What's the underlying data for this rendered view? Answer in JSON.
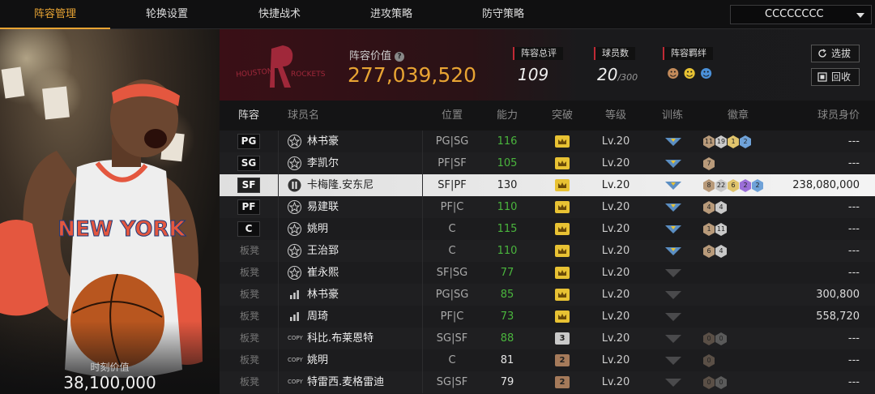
{
  "nav": {
    "tabs": [
      "阵容管理",
      "轮换设置",
      "快捷战术",
      "进攻策略",
      "防守策略"
    ],
    "active_index": 0,
    "account_dropdown": "CCCCCCCC"
  },
  "player_panel": {
    "value_label": "时刻价值",
    "value": "38,100,000"
  },
  "team": {
    "logo_text": "HOUSTON ROCKETS",
    "lineup_value_label": "阵容价值",
    "lineup_value": "277,039,520",
    "rating_label": "阵容总评",
    "rating": "109",
    "players_label": "球员数",
    "players_count": "20",
    "players_max": "/300",
    "bonds_label": "阵容羁绊",
    "buttons": {
      "select": "选拔",
      "recycle": "回收"
    }
  },
  "table": {
    "headers": [
      "阵容",
      "球员名",
      "位置",
      "能力",
      "突破",
      "等级",
      "训练",
      "徽章",
      "球员身价"
    ],
    "rows": [
      {
        "slot": "PG",
        "starter": true,
        "icon": "star",
        "name": "林书豪",
        "pos": "PG|SG",
        "ability": "116",
        "ability_color": "green",
        "breakthrough": "crown",
        "level": "Lv.20",
        "trained": true,
        "badges": [
          [
            "11",
            "#b89a7a"
          ],
          [
            "19",
            "#c9c9c9"
          ],
          [
            "1",
            "#e0c46c"
          ],
          [
            "2",
            "#6fa2d8"
          ]
        ],
        "value": "---"
      },
      {
        "slot": "SG",
        "starter": true,
        "icon": "star",
        "name": "李凯尔",
        "pos": "PF|SF",
        "ability": "105",
        "ability_color": "green",
        "breakthrough": "crown",
        "level": "Lv.20",
        "trained": true,
        "badges": [
          [
            "7",
            "#b89a7a"
          ]
        ],
        "value": "---"
      },
      {
        "slot": "SF",
        "starter": true,
        "icon": "special",
        "name": "卡梅隆.安东尼",
        "pos": "SF|PF",
        "ability": "130",
        "ability_color": "dark",
        "breakthrough": "crown",
        "level": "Lv.20",
        "trained": true,
        "badges": [
          [
            "8",
            "#b89a7a"
          ],
          [
            "22",
            "#c9c9c9"
          ],
          [
            "6",
            "#e0c46c"
          ],
          [
            "2",
            "#9b6fd8"
          ],
          [
            "2",
            "#6fa2d8"
          ]
        ],
        "value": "238,080,000",
        "selected": true
      },
      {
        "slot": "PF",
        "starter": true,
        "icon": "star",
        "name": "易建联",
        "pos": "PF|C",
        "ability": "110",
        "ability_color": "green",
        "breakthrough": "crown",
        "level": "Lv.20",
        "trained": true,
        "badges": [
          [
            "4",
            "#b89a7a"
          ],
          [
            "4",
            "#c9c9c9"
          ]
        ],
        "value": "---"
      },
      {
        "slot": "C",
        "starter": true,
        "icon": "star",
        "name": "姚明",
        "pos": "C",
        "ability": "115",
        "ability_color": "green",
        "breakthrough": "crown",
        "level": "Lv.20",
        "trained": true,
        "badges": [
          [
            "1",
            "#b89a7a"
          ],
          [
            "11",
            "#c9c9c9"
          ]
        ],
        "value": "---"
      },
      {
        "slot": "板凳",
        "starter": false,
        "icon": "star",
        "name": "王治郅",
        "pos": "C",
        "ability": "110",
        "ability_color": "green",
        "breakthrough": "crown",
        "level": "Lv.20",
        "trained": true,
        "badges": [
          [
            "6",
            "#b89a7a"
          ],
          [
            "4",
            "#c9c9c9"
          ]
        ],
        "value": "---"
      },
      {
        "slot": "板凳",
        "starter": false,
        "icon": "star",
        "name": "崔永熙",
        "pos": "SF|SG",
        "ability": "77",
        "ability_color": "green",
        "breakthrough": "crown",
        "level": "Lv.20",
        "trained": false,
        "badges": [],
        "value": "---"
      },
      {
        "slot": "板凳",
        "starter": false,
        "icon": "bars",
        "name": "林书豪",
        "pos": "PG|SG",
        "ability": "85",
        "ability_color": "green",
        "breakthrough": "crown",
        "level": "Lv.20",
        "trained": false,
        "badges": [],
        "value": "300,800"
      },
      {
        "slot": "板凳",
        "starter": false,
        "icon": "bars",
        "name": "周琦",
        "pos": "PF|C",
        "ability": "73",
        "ability_color": "green",
        "breakthrough": "crown",
        "level": "Lv.20",
        "trained": false,
        "badges": [],
        "value": "558,720"
      },
      {
        "slot": "板凳",
        "starter": false,
        "icon": "copy",
        "name": "科比.布莱恩特",
        "pos": "SG|SF",
        "ability": "88",
        "ability_color": "green",
        "breakthrough": "3",
        "level": "Lv.20",
        "trained": false,
        "badges": [
          [
            "0",
            "#5a4f46"
          ],
          [
            "0",
            "#5a5a5a"
          ]
        ],
        "value": "---"
      },
      {
        "slot": "板凳",
        "starter": false,
        "icon": "copy",
        "name": "姚明",
        "pos": "C",
        "ability": "81",
        "ability_color": "white",
        "breakthrough": "2",
        "level": "Lv.20",
        "trained": false,
        "badges": [
          [
            "0",
            "#5a4f46"
          ]
        ],
        "value": "---"
      },
      {
        "slot": "板凳",
        "starter": false,
        "icon": "copy",
        "name": "特雷西.麦格雷迪",
        "pos": "SG|SF",
        "ability": "79",
        "ability_color": "white",
        "breakthrough": "2",
        "level": "Lv.20",
        "trained": false,
        "badges": [
          [
            "0",
            "#5a4f46"
          ],
          [
            "0",
            "#5a5a5a"
          ]
        ],
        "value": "---"
      }
    ]
  },
  "colors": {
    "accent": "#e8a433",
    "green": "#4ab53d",
    "red_tag": "#c02a35"
  }
}
